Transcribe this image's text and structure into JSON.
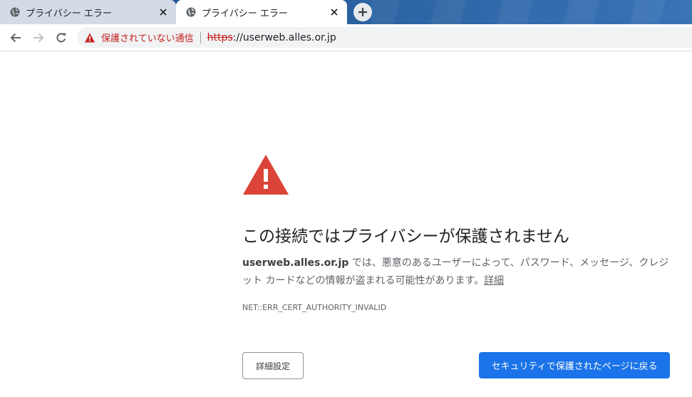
{
  "tabs": [
    {
      "label": "プライバシー エラー",
      "icon": "globe-icon",
      "active": false
    },
    {
      "label": "プライバシー エラー",
      "icon": "globe-icon",
      "active": true
    }
  ],
  "toolbar": {
    "security_label": "保護されていない通信",
    "url_scheme": "https",
    "url_rest": "://userweb.alles.or.jp"
  },
  "interstitial": {
    "headline": "この接続ではプライバシーが保護されません",
    "host": "userweb.alles.or.jp",
    "message": " では、悪意のあるユーザーによって、パスワード、メッセージ、クレジット カードなどの情報が盗まれる可能性があります。",
    "details_link": "詳細",
    "error_code": "NET::ERR_CERT_AUTHORITY_INVALID",
    "advanced_button": "詳細設定",
    "back_button": "セキュリティで保護されたページに戻る"
  },
  "colors": {
    "warning_red": "#db4437",
    "insecure_text": "#c5221f",
    "primary_button": "#1a73e8"
  }
}
